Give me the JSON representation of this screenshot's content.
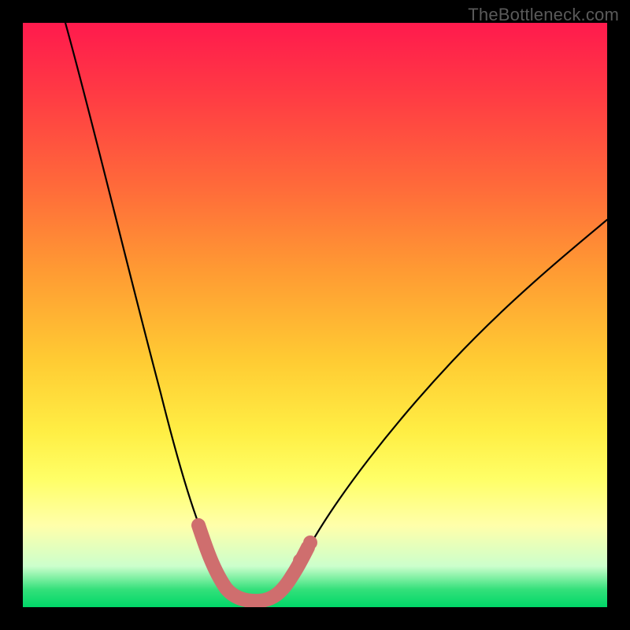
{
  "watermark": "TheBottleneck.com",
  "chart_data": {
    "type": "line",
    "title": "",
    "xlabel": "",
    "ylabel": "",
    "xlim": [
      0,
      100
    ],
    "ylim": [
      0,
      100
    ],
    "series": [
      {
        "name": "bottleneck-curve",
        "color": "#000000",
        "x": [
          5,
          10,
          15,
          20,
          25,
          28,
          30,
          32,
          34,
          36,
          38,
          40,
          42,
          45,
          50,
          55,
          60,
          65,
          70,
          75,
          80,
          85,
          90,
          95,
          100
        ],
        "values": [
          100,
          80,
          63,
          48,
          35,
          28,
          22,
          17,
          12,
          8,
          5,
          3,
          2,
          2,
          6,
          12,
          19,
          26,
          33,
          40,
          46,
          52,
          58,
          63,
          68
        ]
      },
      {
        "name": "highlight-segment",
        "color": "#d46a6a",
        "x": [
          30,
          32,
          34,
          36,
          38,
          40,
          42,
          44,
          46
        ],
        "values": [
          12,
          8,
          5,
          3,
          2,
          2,
          2,
          3,
          6
        ]
      }
    ],
    "gradient_stops": [
      {
        "pos": 0.0,
        "color": "#ff1a4d"
      },
      {
        "pos": 0.5,
        "color": "#ffcc33"
      },
      {
        "pos": 0.8,
        "color": "#ffff66"
      },
      {
        "pos": 0.97,
        "color": "#33e07a"
      },
      {
        "pos": 1.0,
        "color": "#00d768"
      }
    ]
  }
}
